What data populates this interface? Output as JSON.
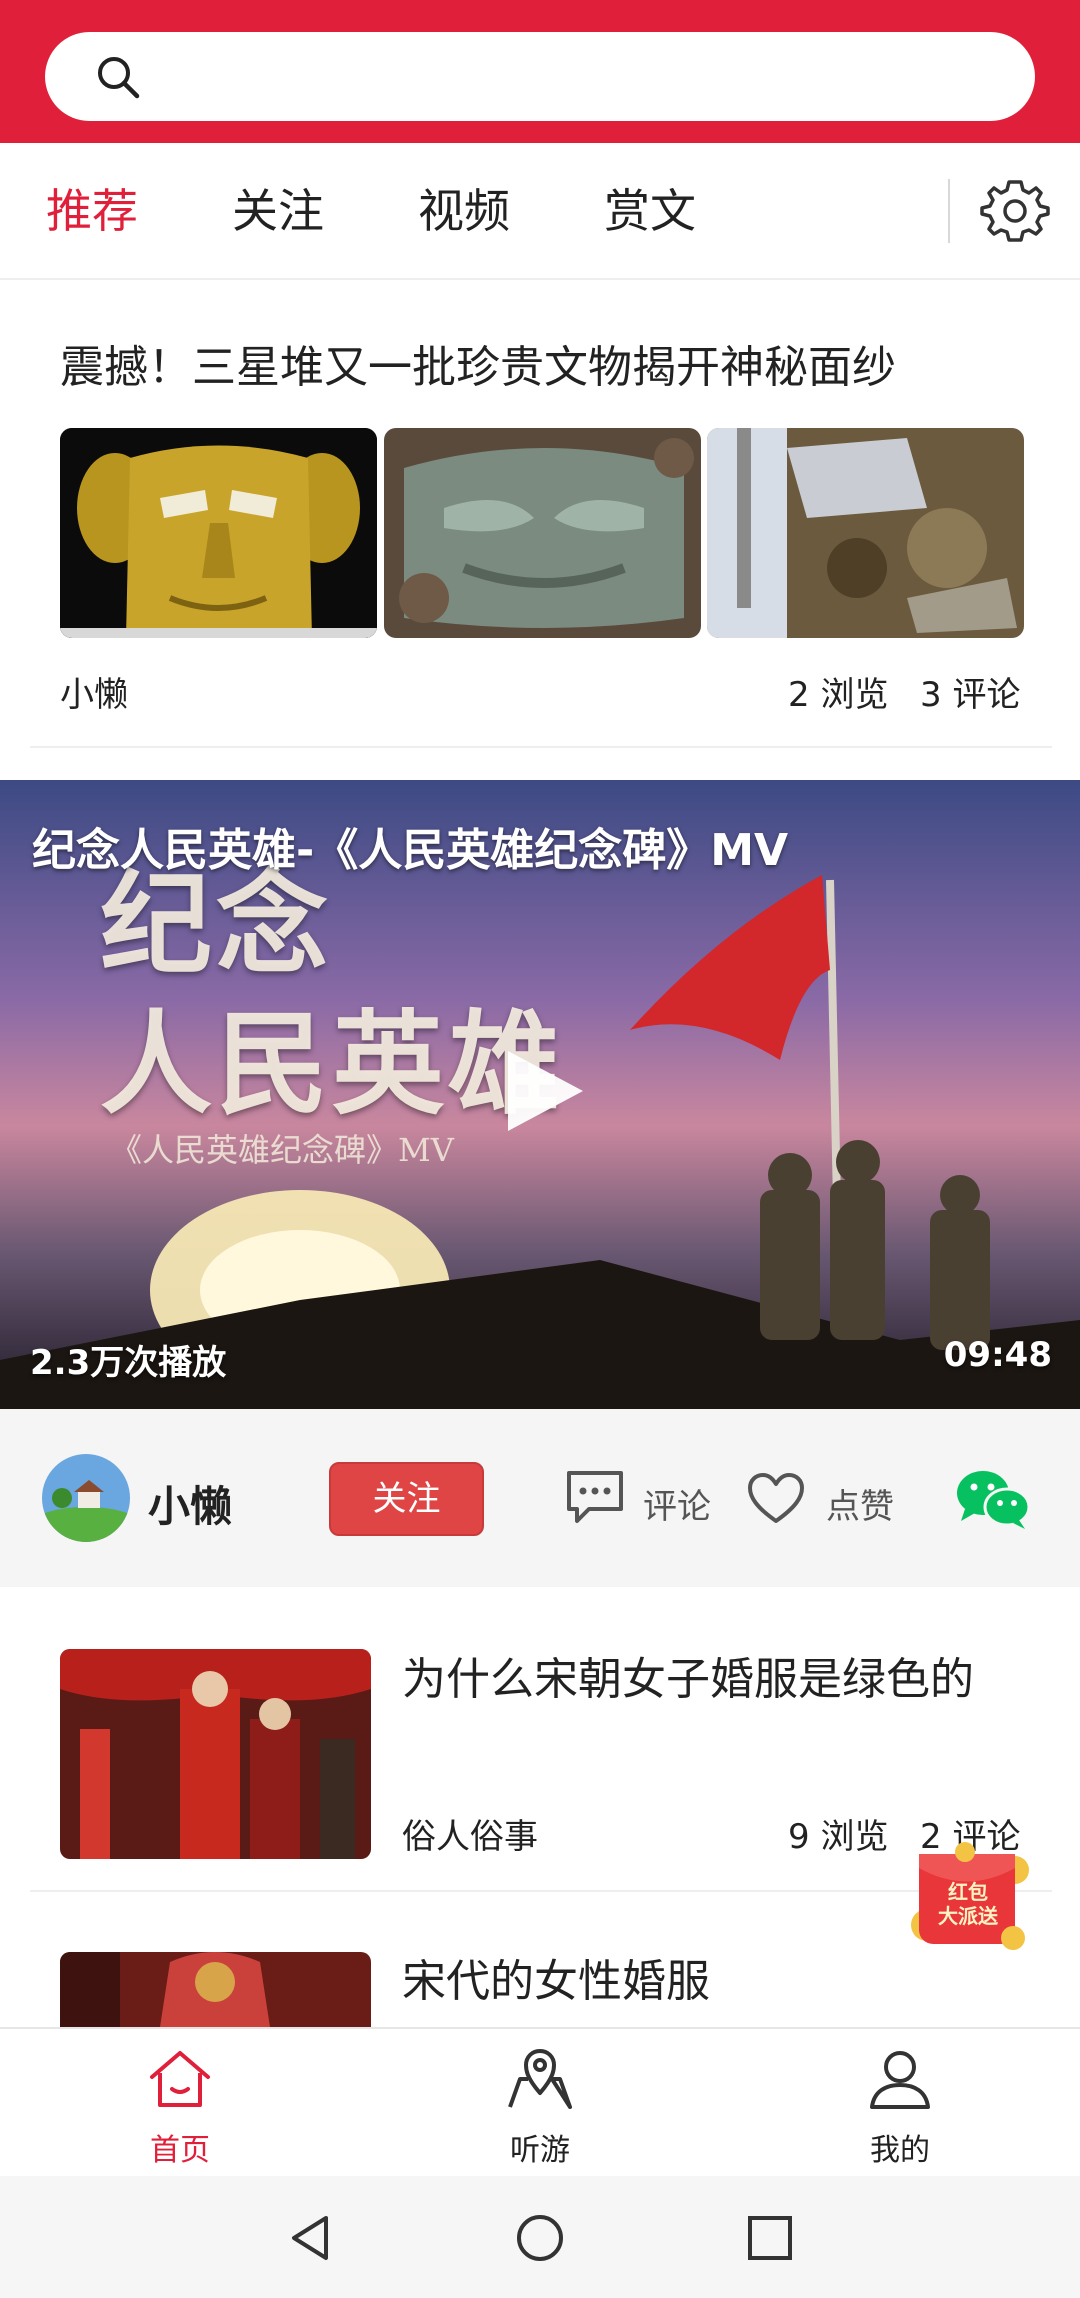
{
  "search": {
    "placeholder": ""
  },
  "tabs": [
    {
      "label": "推荐",
      "active": true
    },
    {
      "label": "关注",
      "active": false
    },
    {
      "label": "视频",
      "active": false
    },
    {
      "label": "赏文",
      "active": false
    }
  ],
  "article1": {
    "title": "震撼！三星堆又一批珍贵文物揭开神秘面纱",
    "author": "小懒",
    "views": "2 浏览",
    "comments": "3 评论"
  },
  "video": {
    "title": "纪念人民英雄-《人民英雄纪念碑》MV",
    "overlay_line1": "纪念",
    "overlay_line2": "人民英雄",
    "overlay_sub": "《人民英雄纪念碑》MV",
    "plays": "2.3万次播放",
    "duration": "09:48"
  },
  "author_bar": {
    "name": "小懒",
    "follow_label": "关注",
    "comment_label": "评论",
    "like_label": "点赞"
  },
  "list": [
    {
      "title": "为什么宋朝女子婚服是绿色的",
      "source": "俗人俗事",
      "views": "9 浏览",
      "comments": "2 评论"
    },
    {
      "title": "宋代的女性婚服"
    }
  ],
  "red_packet": {
    "line1": "红包",
    "line2": "大派送"
  },
  "bottom_nav": [
    {
      "label": "首页",
      "icon": "home-icon",
      "active": true
    },
    {
      "label": "听游",
      "icon": "map-pin-icon",
      "active": false
    },
    {
      "label": "我的",
      "icon": "user-icon",
      "active": false
    }
  ],
  "colors": {
    "brand": "#e0203a",
    "follow": "#e04545",
    "wechat": "#07c160"
  }
}
